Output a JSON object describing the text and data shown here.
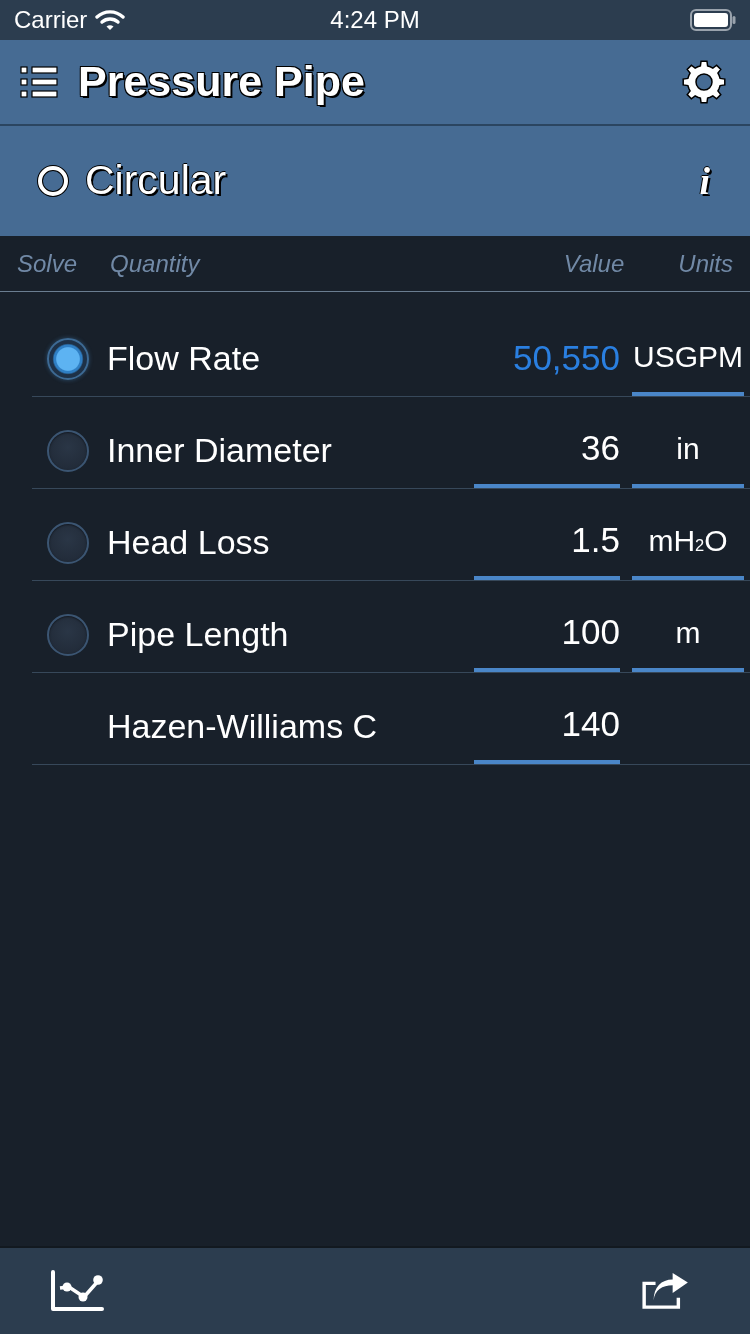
{
  "status_bar": {
    "carrier": "Carrier",
    "time": "4:24 PM"
  },
  "header": {
    "title": "Pressure Pipe"
  },
  "shape": {
    "label": "Circular",
    "info_button": "i"
  },
  "columns": [
    "Solve",
    "Quantity",
    "Value",
    "Units"
  ],
  "rows": [
    {
      "kind": "solvable",
      "selected": true,
      "label": "Flow Rate",
      "value": "50,550",
      "unit": "USGPM"
    },
    {
      "kind": "solvable",
      "selected": false,
      "label": "Inner Diameter",
      "value": "36",
      "unit": "in"
    },
    {
      "kind": "solvable",
      "selected": false,
      "label": "Head Loss",
      "value": "1.5",
      "unit": "mH$_{2}$O"
    },
    {
      "kind": "solvable",
      "selected": false,
      "label": "Pipe Length",
      "value": "100",
      "unit": "m"
    },
    {
      "kind": "fixed",
      "label": "Hazen-Williams C",
      "value": "140"
    }
  ]
}
